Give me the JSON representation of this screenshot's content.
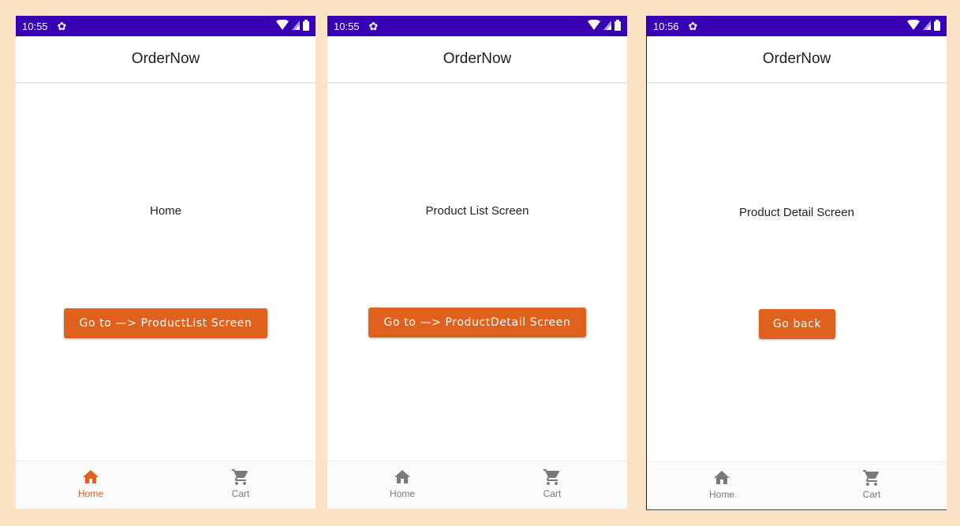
{
  "colors": {
    "status_bar": "#3700b3",
    "accent": "#e0601e",
    "background": "#fde3c6",
    "nav_inactive": "#7a7a7a"
  },
  "screens": [
    {
      "status_time": "10:55",
      "app_title": "OrderNow",
      "body_text": "Home",
      "button_label": "Go to —> ProductList Screen",
      "nav": {
        "home_label": "Home",
        "cart_label": "Cart",
        "active": "home"
      }
    },
    {
      "status_time": "10:55",
      "app_title": "OrderNow",
      "body_text": "Product List Screen",
      "button_label": "Go to —> ProductDetail Screen",
      "nav": {
        "home_label": "Home",
        "cart_label": "Cart",
        "active": "none"
      }
    },
    {
      "status_time": "10:56",
      "app_title": "OrderNow",
      "body_text": "Product Detail Screen",
      "button_label": "Go back",
      "nav": {
        "home_label": "Home",
        "cart_label": "Cart",
        "active": "none"
      }
    }
  ],
  "icons": {
    "status": [
      "settings-icon",
      "wifi-icon",
      "signal-icon",
      "battery-icon"
    ],
    "nav": [
      "home-icon",
      "cart-icon"
    ]
  }
}
